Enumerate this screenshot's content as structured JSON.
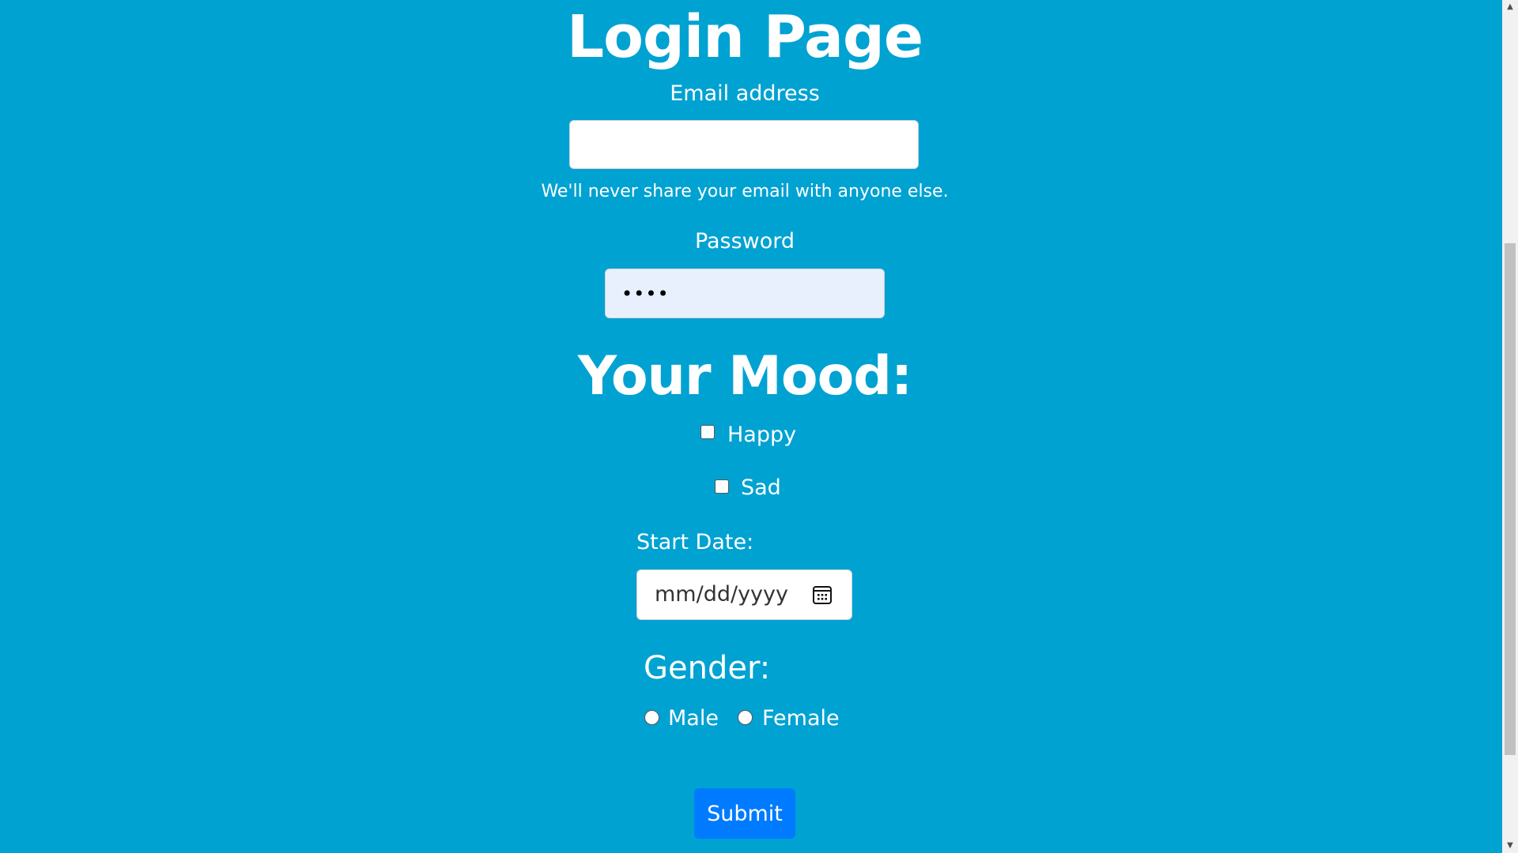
{
  "page": {
    "title": "Login Page"
  },
  "email": {
    "label": "Email address",
    "value": "",
    "help": "We'll never share your email with anyone else."
  },
  "password": {
    "label": "Password",
    "value": "••••"
  },
  "mood": {
    "heading": "Your Mood:",
    "options": [
      {
        "label": "Happy",
        "checked": false
      },
      {
        "label": "Sad",
        "checked": false
      }
    ]
  },
  "start_date": {
    "label": "Start Date:",
    "placeholder": "mm/dd/yyyy",
    "icon": "calendar-icon"
  },
  "gender": {
    "label": "Gender:",
    "options": [
      {
        "label": "Male",
        "selected": false
      },
      {
        "label": "Female",
        "selected": false
      }
    ]
  },
  "submit": {
    "label": "Submit"
  },
  "colors": {
    "background": "#00a2d2",
    "submit": "#007bff",
    "password_autofill": "#e8f0fe"
  }
}
